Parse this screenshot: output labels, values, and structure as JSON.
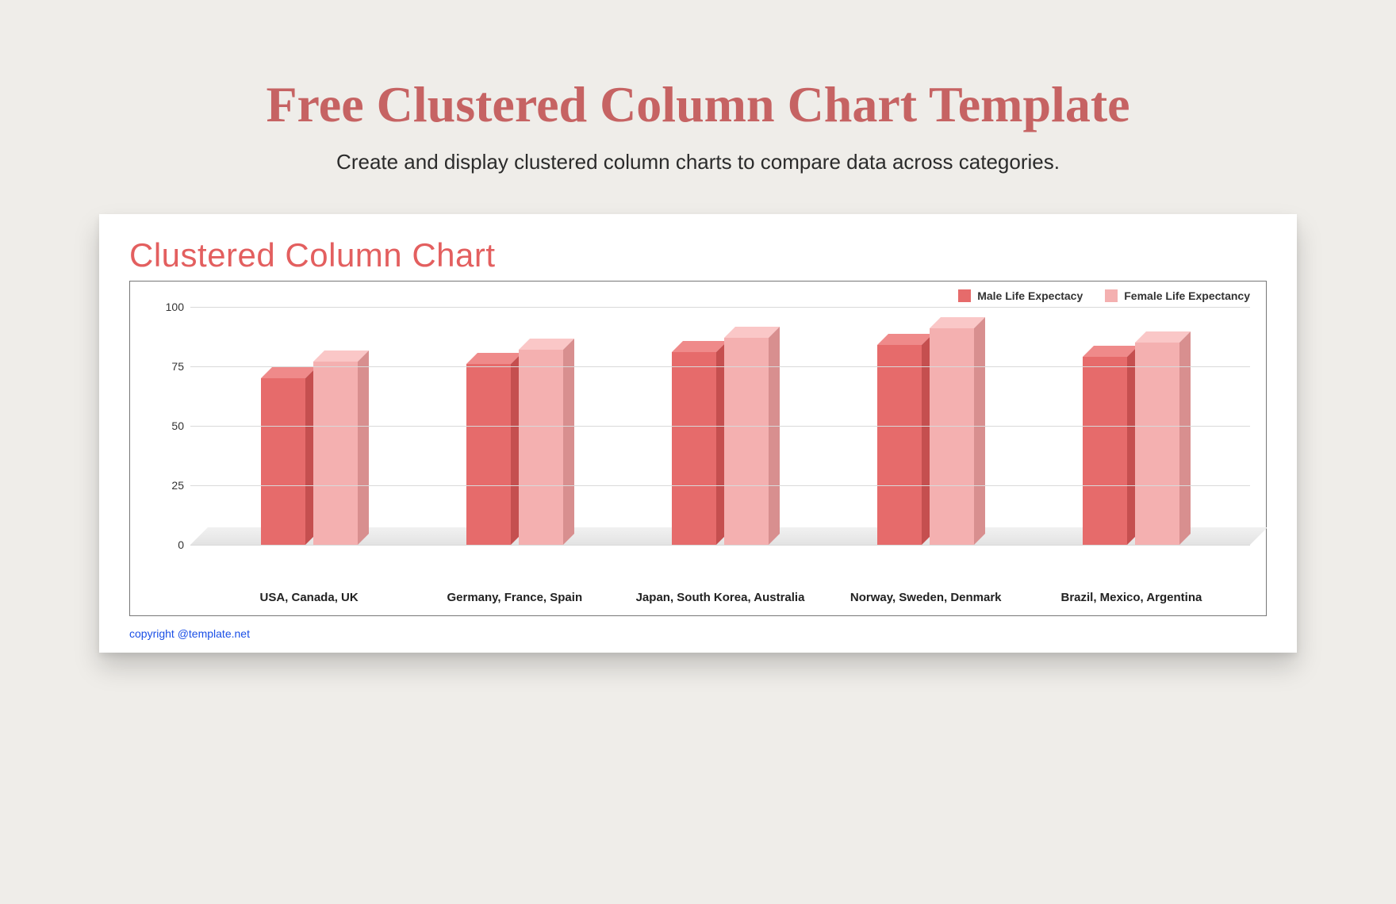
{
  "header": {
    "title": "Free Clustered Column Chart Template",
    "subtitle": "Create and display clustered column charts to compare data across categories."
  },
  "card": {
    "chart_title": "Clustered Column Chart",
    "copyright": "copyright @template.net"
  },
  "legend": {
    "series1": "Male Life Expectacy",
    "series2": "Female Life Expectancy"
  },
  "colors": {
    "male_front": "#e66b6b",
    "male_side": "#c54f4f",
    "male_top": "#ef8a8a",
    "female_front": "#f4b0b0",
    "female_side": "#d88f8f",
    "female_top": "#fac7c7"
  },
  "chart_data": {
    "type": "bar",
    "title": "Clustered Column Chart",
    "xlabel": "",
    "ylabel": "",
    "ylim": [
      0,
      100
    ],
    "yticks": [
      0,
      25,
      50,
      75,
      100
    ],
    "categories": [
      "USA, Canada, UK",
      "Germany, France, Spain",
      "Japan, South Korea, Australia",
      "Norway, Sweden, Denmark",
      "Brazil, Mexico, Argentina"
    ],
    "series": [
      {
        "name": "Male Life Expectacy",
        "values": [
          70,
          76,
          81,
          84,
          79
        ]
      },
      {
        "name": "Female Life Expectancy",
        "values": [
          77,
          82,
          87,
          91,
          85
        ]
      }
    ],
    "legend_position": "top-right",
    "grid": true
  }
}
